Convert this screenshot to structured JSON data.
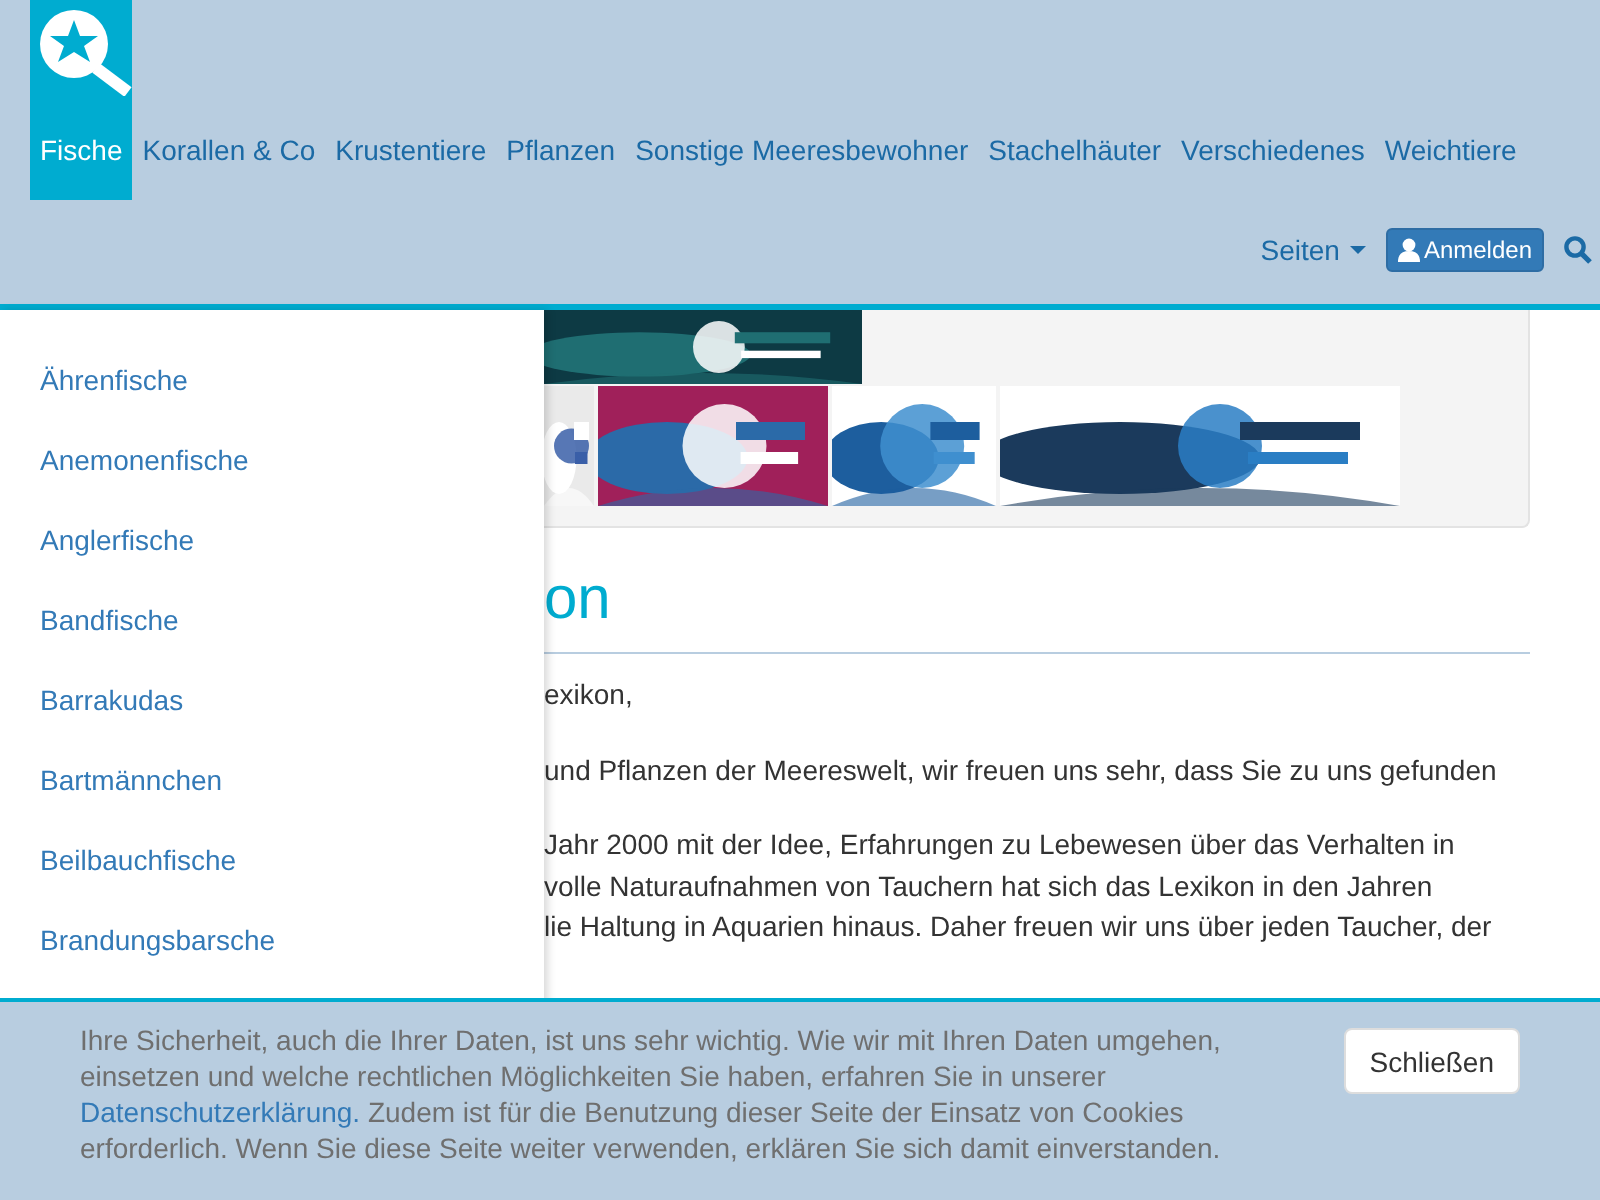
{
  "nav": {
    "items": [
      {
        "label": "Fische",
        "selected": true
      },
      {
        "label": "Korallen & Co",
        "selected": false
      },
      {
        "label": "Krustentiere",
        "selected": false
      },
      {
        "label": "Pflanzen",
        "selected": false
      },
      {
        "label": "Sonstige Meeresbewohner",
        "selected": false
      },
      {
        "label": "Stachelhäuter",
        "selected": false
      },
      {
        "label": "Verschiedenes",
        "selected": false
      },
      {
        "label": "Weichtiere",
        "selected": false
      }
    ],
    "pages_menu": "Seiten",
    "login_button": "Anmelden"
  },
  "sidebar": {
    "items": [
      "Ährenfische",
      "Anemonenfische",
      "Anglerfische",
      "Bandfische",
      "Barrakudas",
      "Bartmännchen",
      "Beilbauchfische",
      "Brandungsbarsche"
    ]
  },
  "article": {
    "heading": "on",
    "paragraphs": [
      [
        "exikon,"
      ],
      [
        "und Pflanzen der Meereswelt, wir freuen uns sehr, dass Sie zu uns gefunden"
      ],
      [
        "Jahr 2000 mit der Idee, Erfahrungen zu Lebewesen über das Verhalten in",
        "volle Naturaufnahmen von Tauchern hat sich das Lexikon in den Jahren",
        "lie Haltung in Aquarien hinaus. Daher freuen wir uns über jeden Taucher, der"
      ]
    ]
  },
  "cookie_notice": {
    "text_before": "Ihre Sicherheit, auch die Ihrer Daten, ist uns sehr wichtig. Wie wir mit Ihren Daten umgehen, einsetzen und welche rechtlichen Möglichkeiten Sie haben, erfahren Sie in unserer ",
    "link": "Datenschutzerklärung.",
    "text_after": " Zudem ist für die Benutzung dieser Seite der Einsatz von Cookies erforderlich. Wenn Sie diese Seite weiter verwenden, erklären Sie sich damit einverstanden.",
    "button": "Schließen"
  }
}
